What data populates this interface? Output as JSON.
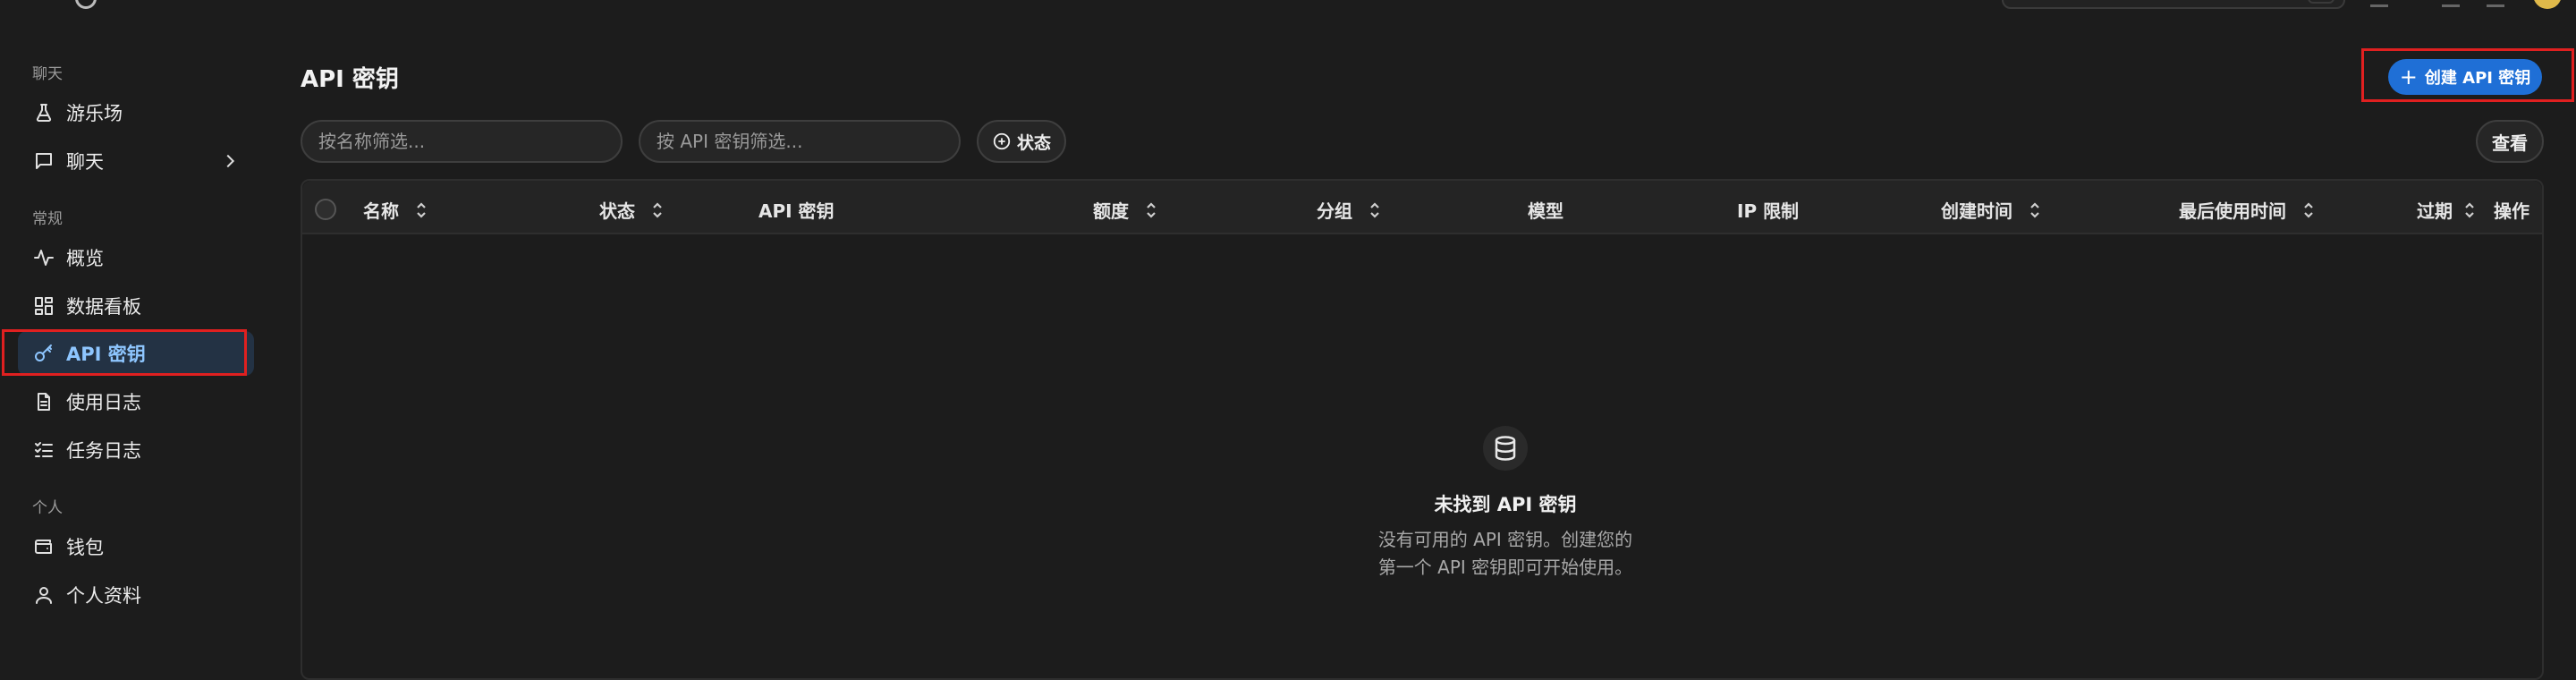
{
  "sidebar": {
    "sections": {
      "chat": "聊天",
      "general": "常规",
      "personal": "个人"
    },
    "items": [
      {
        "label": "游乐场",
        "icon": "flask-icon"
      },
      {
        "label": "聊天",
        "icon": "message-square-icon"
      },
      {
        "label": "概览",
        "icon": "activity-icon"
      },
      {
        "label": "数据看板",
        "icon": "dashboard-grid-icon"
      },
      {
        "label": "API 密钥",
        "icon": "key-icon",
        "active": true
      },
      {
        "label": "使用日志",
        "icon": "file-text-icon"
      },
      {
        "label": "任务日志",
        "icon": "list-checks-icon"
      },
      {
        "label": "钱包",
        "icon": "wallet-icon"
      },
      {
        "label": "个人资料",
        "icon": "user-icon"
      }
    ]
  },
  "main": {
    "title": "API 密钥",
    "create_button": "创建 API 密钥",
    "filters": {
      "name_placeholder": "按名称筛选...",
      "key_placeholder": "按 API 密钥筛选...",
      "status_label": "状态"
    },
    "view_button": "查看",
    "table": {
      "columns": [
        "名称",
        "状态",
        "API 密钥",
        "额度",
        "分组",
        "模型",
        "IP 限制",
        "创建时间",
        "最后使用时间",
        "过期",
        "操作"
      ]
    },
    "empty": {
      "icon": "database-icon",
      "title": "未找到 API 密钥",
      "line1": "没有可用的 API 密钥。创建您的",
      "line2": "第一个 API 密钥即可开始使用。"
    }
  },
  "colors": {
    "background": "#1c1c1c",
    "accent": "#1f6fd6",
    "active_item_bg": "#233244",
    "active_item_text": "#8ec6ff",
    "highlight": "#e02020"
  }
}
